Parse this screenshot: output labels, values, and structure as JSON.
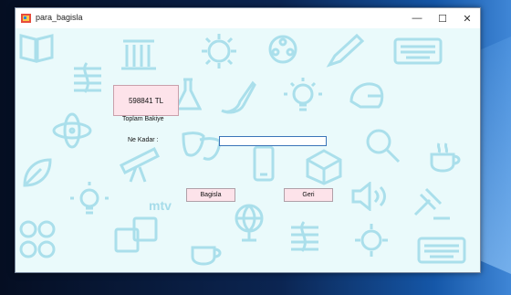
{
  "window": {
    "title": "para_bagisla",
    "controls": {
      "minimize": "—",
      "maximize": "☐",
      "close": "✕"
    }
  },
  "form": {
    "balance_value": "598841 TL",
    "balance_label": "Toplam Bakiye",
    "amount_label": "Ne Kadar :",
    "amount_value": "",
    "donate_label": "Bagisla",
    "back_label": "Geri"
  },
  "background": {
    "watermark_text": "mtv",
    "icons": [
      "book-icon",
      "music-note-icon",
      "column-icon",
      "virus-icon",
      "film-reel-icon",
      "pencil-icon",
      "keyboard-icon",
      "chemistry-flask-icon",
      "paint-brush-icon",
      "lightbulb-icon",
      "helmet-icon",
      "atom-icon",
      "theater-masks-icon",
      "phone-icon",
      "magnifier-icon",
      "tea-cup-icon",
      "telescope-icon",
      "cube-icon",
      "speaker-icon",
      "gavel-icon",
      "globe-icon",
      "language-icon",
      "calculator-icon",
      "leaf-icon"
    ]
  },
  "colors": {
    "client_bg": "#eafafb",
    "doodle": "#9fdbe9",
    "button_bg": "#fde3ea",
    "input_border": "#3a74b8"
  }
}
